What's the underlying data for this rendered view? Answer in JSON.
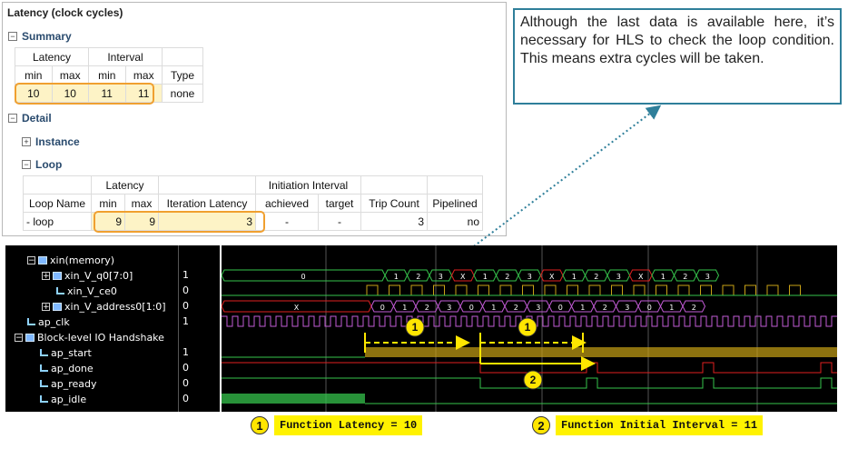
{
  "report": {
    "title": "Latency (clock cycles)",
    "summary_label": "Summary",
    "detail_label": "Detail",
    "instance_label": "Instance",
    "loop_label": "Loop",
    "summary": {
      "h_latency": "Latency",
      "h_interval": "Interval",
      "h_min1": "min",
      "h_max1": "max",
      "h_min2": "min",
      "h_max2": "max",
      "h_type": "Type",
      "v_lat_min": "10",
      "v_lat_max": "10",
      "v_int_min": "11",
      "v_int_max": "11",
      "v_type": "none"
    },
    "loop": {
      "h_latency": "Latency",
      "h_ii": "Initiation Interval",
      "h_loop_name": "Loop Name",
      "h_min": "min",
      "h_max": "max",
      "h_iter": "Iteration Latency",
      "h_achieved": "achieved",
      "h_target": "target",
      "h_trip": "Trip Count",
      "h_pipelined": "Pipelined",
      "v_name": "- loop",
      "v_min": "9",
      "v_max": "9",
      "v_iter": "3",
      "v_achieved": "-",
      "v_target": "-",
      "v_trip": "3",
      "v_pipelined": "no"
    }
  },
  "callout": {
    "text": "Although the last data is available here, it’s necessary for HLS to check the loop condition. This means extra cycles will be taken."
  },
  "waveform": {
    "signals": [
      {
        "name": "xin(memory)",
        "value": ""
      },
      {
        "name": "xin_V_q0[7:0]",
        "value": "1"
      },
      {
        "name": "xin_V_ce0",
        "value": "0"
      },
      {
        "name": "xin_V_address0[1:0]",
        "value": "0"
      },
      {
        "name": "ap_clk",
        "value": "1"
      },
      {
        "name": "Block-level IO Handshake",
        "value": ""
      },
      {
        "name": "ap_start",
        "value": "1"
      },
      {
        "name": "ap_done",
        "value": "0"
      },
      {
        "name": "ap_ready",
        "value": "0"
      },
      {
        "name": "ap_idle",
        "value": "0"
      }
    ],
    "q0_values": [
      "0",
      "1",
      "2",
      "3",
      "X",
      "1",
      "2",
      "3",
      "X",
      "1",
      "2",
      "3",
      "X",
      "1",
      "2",
      "3"
    ],
    "addr_values": [
      "X",
      "0",
      "1",
      "2",
      "3",
      "0",
      "1",
      "2",
      "3",
      "0",
      "1",
      "2",
      "3",
      "0",
      "1",
      "2"
    ],
    "markers": [
      "1",
      "1",
      "2"
    ]
  },
  "legend": [
    {
      "num": "1",
      "text": "Function Latency = 10"
    },
    {
      "num": "2",
      "text": "Function Initial Interval = 11"
    }
  ],
  "colors": {
    "highlight_border": "#f0a030",
    "highlight_fill": "#fdf3c6",
    "callout_border": "#2f7f9a",
    "wave_bg": "#000000",
    "wave_green": "#36c34c",
    "wave_purple": "#c25bd6",
    "wave_red": "#e02020",
    "wave_yellow": "#c9a216",
    "badge": "#ffe600"
  }
}
